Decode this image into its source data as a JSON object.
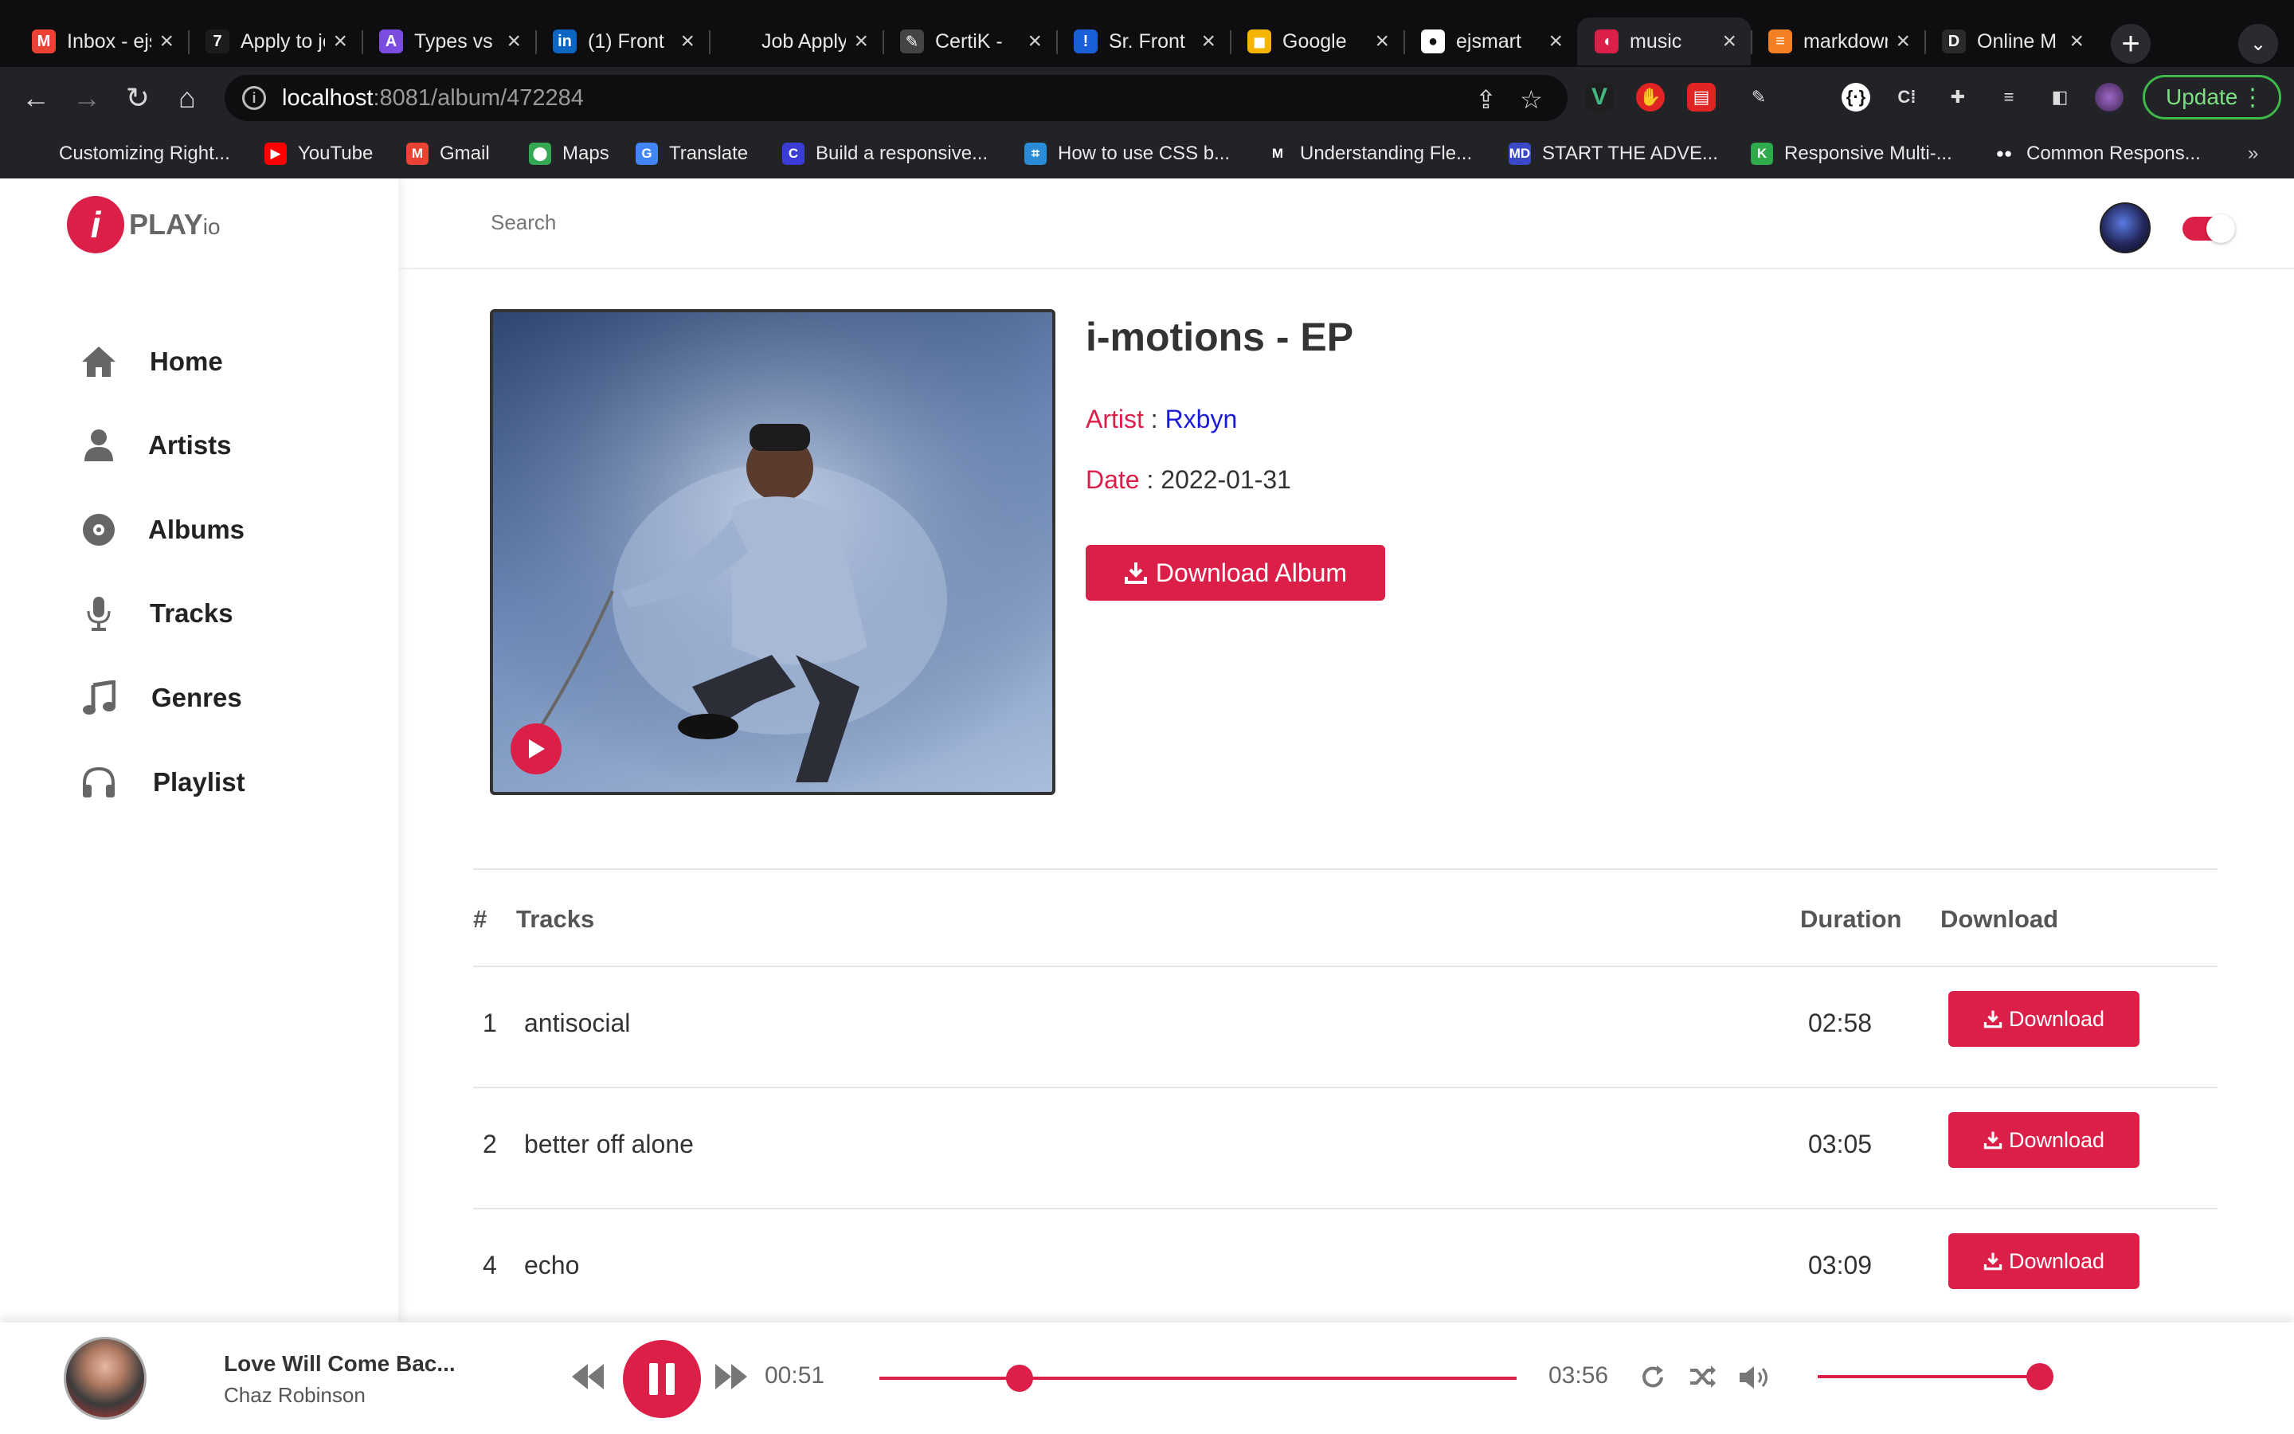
{
  "browser": {
    "tabs": [
      {
        "title": "Inbox - ejsmart",
        "color": "#ea4335",
        "glyph": "M"
      },
      {
        "title": "Apply to job",
        "color": "#1c1c1c",
        "glyph": "7"
      },
      {
        "title": "Types vs",
        "color": "#7b4ce0",
        "glyph": "A"
      },
      {
        "title": "(1) Front",
        "color": "#0a66c2",
        "glyph": "in"
      },
      {
        "title": "Job Apply",
        "color": "#0e0e10",
        "glyph": ""
      },
      {
        "title": "CertiK -",
        "color": "#444",
        "glyph": "✎"
      },
      {
        "title": "Sr. Front",
        "color": "#1a5fd8",
        "glyph": "!"
      },
      {
        "title": "Google",
        "color": "#f4b400",
        "glyph": "◼"
      },
      {
        "title": "ejsmart",
        "color": "#ffffff",
        "glyph": "●"
      },
      {
        "title": "music",
        "color": "#dc1f48",
        "glyph": "◖",
        "active": true
      },
      {
        "title": "markdown",
        "color": "#f48024",
        "glyph": "≡"
      },
      {
        "title": "Online M",
        "color": "#2a2a2a",
        "glyph": "D"
      }
    ],
    "url_host": "localhost",
    "url_rest": ":8081/album/472284",
    "update_label": "Update",
    "bookmarks": [
      {
        "label": "Customizing Right...",
        "color": "#222327",
        "glyph": ""
      },
      {
        "label": "YouTube",
        "color": "#ff0000",
        "glyph": "▶"
      },
      {
        "label": "Gmail",
        "color": "#ea4335",
        "glyph": "M"
      },
      {
        "label": "Maps",
        "color": "#34a853",
        "glyph": "⬤"
      },
      {
        "label": "Translate",
        "color": "#4285f4",
        "glyph": "G"
      },
      {
        "label": "Build a responsive...",
        "color": "#3b3bd6",
        "glyph": "C"
      },
      {
        "label": "How to use CSS b...",
        "color": "#2a8bd6",
        "glyph": "⌗"
      },
      {
        "label": "Understanding Fle...",
        "color": "#222327",
        "glyph": "M"
      },
      {
        "label": "START THE ADVE...",
        "color": "#3a49c8",
        "glyph": "MD"
      },
      {
        "label": "Responsive Multi-...",
        "color": "#2eaa4a",
        "glyph": "K"
      },
      {
        "label": "Common Respons...",
        "color": "#222327",
        "glyph": "●●"
      }
    ]
  },
  "app": {
    "logo_word": "PLAY",
    "logo_suffix": "io",
    "search_placeholder": "Search",
    "nav": [
      {
        "label": "Home",
        "icon": "home-icon"
      },
      {
        "label": "Artists",
        "icon": "user-icon"
      },
      {
        "label": "Albums",
        "icon": "disc-icon"
      },
      {
        "label": "Tracks",
        "icon": "microphone-icon"
      },
      {
        "label": "Genres",
        "icon": "music-note-icon"
      },
      {
        "label": "Playlist",
        "icon": "headphones-icon"
      }
    ],
    "album": {
      "title": "i-motions - EP",
      "artist_key": "Artist",
      "artist": "Rxbyn",
      "date_key": "Date",
      "date": "2022-01-31",
      "download_album": "Download Album"
    },
    "table": {
      "headers": {
        "num": "#",
        "tracks": "Tracks",
        "duration": "Duration",
        "download": "Download"
      },
      "rows": [
        {
          "num": "1",
          "name": "antisocial",
          "duration": "02:58",
          "download": "Download"
        },
        {
          "num": "2",
          "name": "better off alone",
          "duration": "03:05",
          "download": "Download"
        },
        {
          "num": "4",
          "name": "echo",
          "duration": "03:09",
          "download": "Download"
        }
      ]
    },
    "player": {
      "title": "Love Will Come Bac...",
      "artist": "Chaz Robinson",
      "elapsed": "00:51",
      "total": "03:56",
      "progress": 0.22,
      "volume": 1.0
    },
    "colors": {
      "accent": "#dc1f48",
      "link": "#1a1ad8"
    }
  }
}
